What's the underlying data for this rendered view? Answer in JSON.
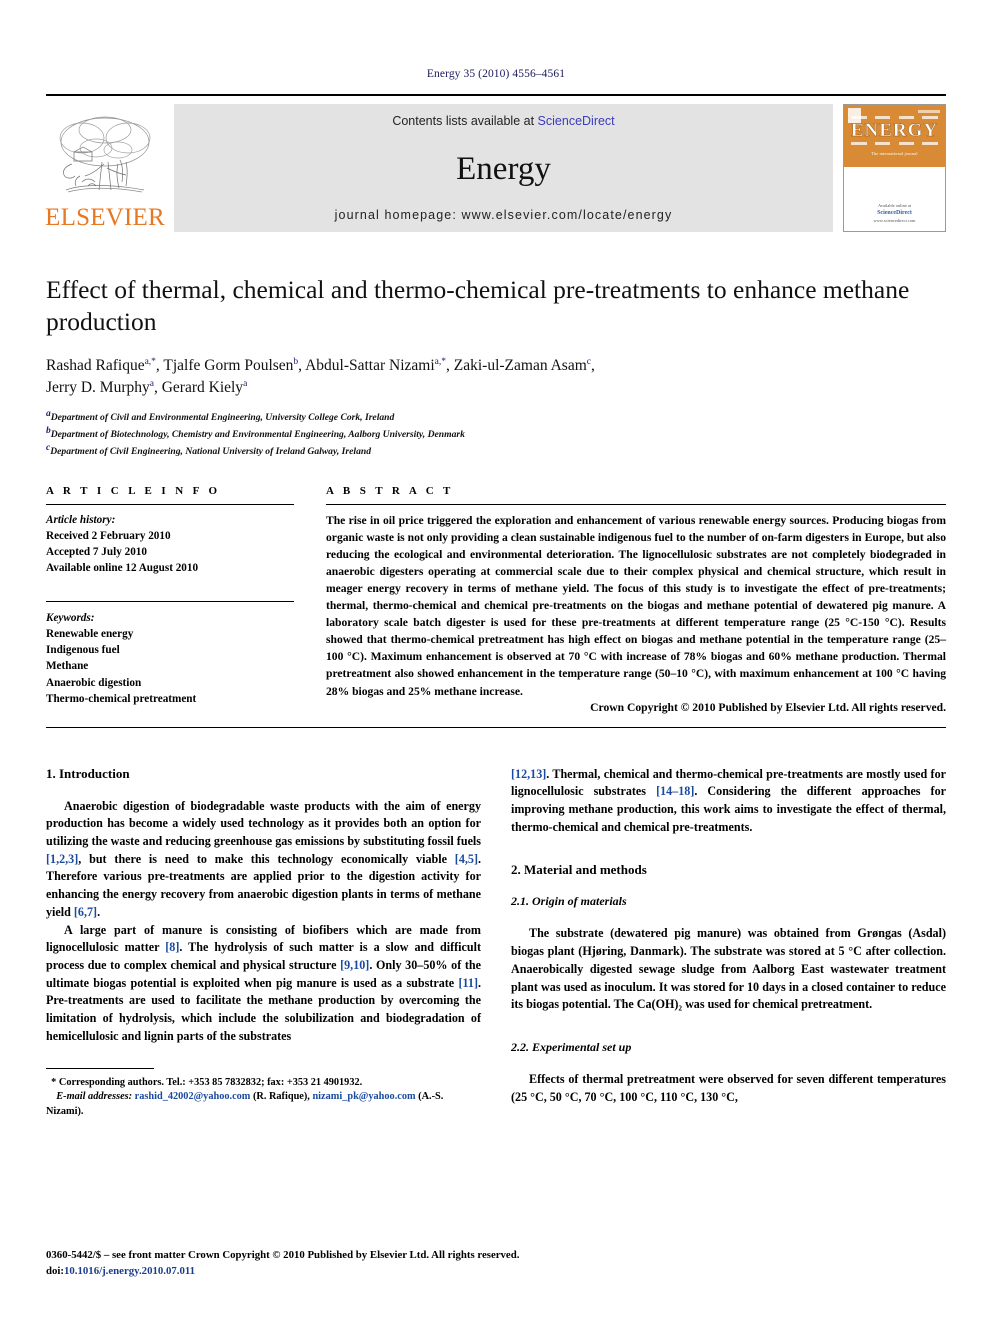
{
  "running_head": "Energy 35 (2010) 4556–4561",
  "masthead": {
    "publisher_name": "ELSEVIER",
    "contents_prefix": "Contents lists available at",
    "contents_link": "ScienceDirect",
    "journal_name": "Energy",
    "homepage": "journal homepage: www.elsevier.com/locate/energy",
    "cover_title": "ENERGY",
    "cover_subtitle": "The international journal",
    "cover_footer_line1": "Available online at",
    "cover_footer_line2": "ScienceDirect",
    "cover_footer_line3": "www.sciencedirect.com",
    "link_color": "#3b3bbd",
    "accent_color": "#E87722",
    "cover_bg": "#D98A34"
  },
  "article": {
    "title": "Effect of thermal, chemical and thermo-chemical pre-treatments to enhance methane production",
    "authors_line1_parts": [
      {
        "name": "Rashad Rafique",
        "sup": "a,*"
      },
      {
        "name": "Tjalfe Gorm Poulsen",
        "sup": "b"
      },
      {
        "name": "Abdul-Sattar Nizami",
        "sup": "a,*"
      },
      {
        "name": "Zaki-ul-Zaman Asam",
        "sup": "c"
      }
    ],
    "authors_line2_parts": [
      {
        "name": "Jerry D. Murphy",
        "sup": "a"
      },
      {
        "name": "Gerard Kiely",
        "sup": "a"
      }
    ],
    "affiliations": [
      {
        "sup": "a",
        "text": "Department of Civil and Environmental Engineering, University College Cork, Ireland"
      },
      {
        "sup": "b",
        "text": "Department of Biotechnology, Chemistry and Environmental Engineering, Aalborg University, Denmark"
      },
      {
        "sup": "c",
        "text": "Department of Civil Engineering, National University of Ireland Galway, Ireland"
      }
    ]
  },
  "article_info": {
    "heading": "A R T I C L E   I N F O",
    "history_label": "Article history:",
    "history": [
      "Received 2 February 2010",
      "Accepted 7 July 2010",
      "Available online 12 August 2010"
    ],
    "keywords_label": "Keywords:",
    "keywords": [
      "Renewable energy",
      "Indigenous fuel",
      "Methane",
      "Anaerobic digestion",
      "Thermo-chemical pretreatment"
    ]
  },
  "abstract": {
    "heading": "A B S T R A C T",
    "text": "The rise in oil price triggered the exploration and enhancement of various renewable energy sources. Producing biogas from organic waste is not only providing a clean sustainable indigenous fuel to the number of on-farm digesters in Europe, but also reducing the ecological and environmental deterioration. The lignocellulosic substrates are not completely biodegraded in anaerobic digesters operating at commercial scale due to their complex physical and chemical structure, which result in meager energy recovery in terms of methane yield. The focus of this study is to investigate the effect of pre-treatments; thermal, thermo-chemical and chemical pre-treatments on the biogas and methane potential of dewatered pig manure. A laboratory scale batch digester is used for these pre-treatments at different temperature range (25 °C-150 °C). Results showed that thermo-chemical pretreatment has high effect on biogas and methane potential in the temperature range (25–100 °C). Maximum enhancement is observed at 70 °C with increase of 78% biogas and 60% methane production. Thermal pretreatment also showed enhancement in the temperature range (50–10 °C), with maximum enhancement at 100 °C having 28% biogas and 25% methane increase.",
    "copyright": "Crown Copyright © 2010 Published by Elsevier Ltd. All rights reserved."
  },
  "sections": {
    "intro_heading": "1.  Introduction",
    "intro_p1_a": "Anaerobic digestion of biodegradable waste products with the aim of energy production has become a widely used technology as it provides both an option for utilizing the waste and reducing greenhouse gas emissions by substituting fossil fuels ",
    "intro_p1_ref1": "[1,2,3]",
    "intro_p1_b": ", but there is need to make this technology economically viable ",
    "intro_p1_ref2": "[4,5]",
    "intro_p1_c": ". Therefore various pre-treatments are applied prior to the digestion activity for enhancing the energy recovery from anaerobic digestion plants in terms of methane yield ",
    "intro_p1_ref3": "[6,7]",
    "intro_p1_d": ".",
    "intro_p2_a": "A large part of manure is consisting of biofibers which are made from lignocellulosic matter ",
    "intro_p2_ref1": "[8]",
    "intro_p2_b": ". The hydrolysis of such matter is a slow and difficult process due to complex chemical and physical structure ",
    "intro_p2_ref2": "[9,10]",
    "intro_p2_c": ". Only 30–50% of the ultimate biogas potential is exploited when pig manure is used as a substrate ",
    "intro_p2_ref3": "[11]",
    "intro_p2_d": ". Pre-treatments are used to facilitate the methane production by overcoming the limitation of hydrolysis, which include the solubilization and biodegradation of hemicellulosic and lignin parts of the substrates ",
    "rcol_ref_start": "[12,13]",
    "rcol_p_a": ". Thermal, chemical and thermo-chemical pre-treatments are mostly used for lignocellulosic substrates ",
    "rcol_ref2": "[14–18]",
    "rcol_p_b": ". Considering the different approaches for improving methane production, this work aims to investigate the effect of thermal, thermo-chemical and chemical pre-treatments.",
    "materials_heading": "2.  Material and methods",
    "origin_heading": "2.1.  Origin of materials",
    "origin_p": "The substrate (dewatered pig manure) was obtained from Grøngas (Asdal) biogas plant (Hjøring, Danmark). The substrate was stored at 5 °C after collection. Anaerobically digested sewage sludge from Aalborg East wastewater treatment plant was used as inoculum. It was stored for 10 days in a closed container to reduce its biogas potential. The Ca(OH)₂ was used for chemical pretreatment.",
    "experimental_heading": "2.2.  Experimental set up",
    "experimental_p": "Effects of thermal pretreatment were observed for seven different temperatures (25 °C, 50 °C, 70 °C, 100 °C, 110 °C, 130 °C,"
  },
  "footnote": {
    "star": "*",
    "corresponding": "Corresponding authors. Tel.: +353 85 7832832; fax: +353 21 4901932.",
    "email_label": "E-mail addresses:",
    "email1": "rashid_42002@yahoo.com",
    "email1_owner": "(R. Rafique),",
    "email2": "nizami_pk@yahoo.com",
    "email2_owner": "(A.-S. Nizami)."
  },
  "page_footer": {
    "line1": "0360-5442/$ – see front matter Crown Copyright © 2010 Published by Elsevier Ltd. All rights reserved.",
    "doi_label": "doi:",
    "doi": "10.1016/j.energy.2010.07.011"
  }
}
